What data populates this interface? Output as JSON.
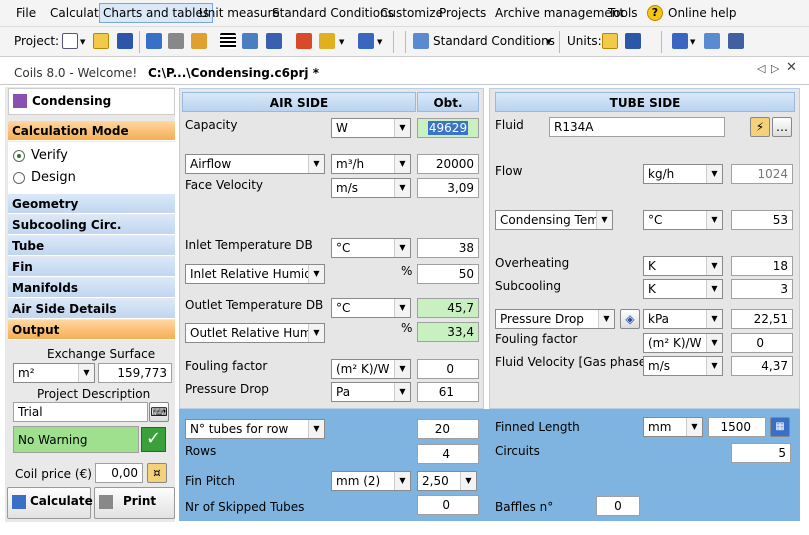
{
  "menu": [
    "File",
    "Calculate",
    "Charts and tables",
    "Unit measure",
    "Standard Conditions",
    "Customize",
    "Projects",
    "Archive management",
    "Tools",
    "Online help"
  ],
  "toolbar": {
    "project_label": "Project:",
    "std_cond": "Standard Conditions",
    "units_label": "Units:"
  },
  "tabs": {
    "welcome": "Coils 8.0 - Welcome!",
    "active": "C:\\P...\\Condensing.c6prj *"
  },
  "left": {
    "title": "Condensing",
    "calc_mode": "Calculation Mode",
    "verify": "Verify",
    "design": "Design",
    "nav": [
      "Geometry",
      "Subcooling Circ.",
      "Tube",
      "Fin",
      "Manifolds",
      "Air Side Details",
      "Output"
    ],
    "exchange_surface_label": "Exchange Surface",
    "exchange_unit": "m²",
    "exchange_value": "159,773",
    "project_desc_label": "Project Description",
    "project_desc": "Trial",
    "warning": "No Warning",
    "coil_price_label": "Coil price (€)",
    "coil_price": "0,00",
    "calculate": "Calculate",
    "print": "Print"
  },
  "air": {
    "header": "AIR SIDE",
    "obt": "Obt.",
    "capacity_label": "Capacity",
    "capacity_unit": "W",
    "capacity_value": "49629",
    "airflow_sel": "Airflow",
    "airflow_unit": "m³/h",
    "airflow_value": "20000",
    "face_vel_label": "Face Velocity",
    "face_vel_unit": "m/s",
    "face_vel_value": "3,09",
    "inlet_temp_label": "Inlet Temperature DB",
    "inlet_temp_unit": "°C",
    "inlet_temp_value": "38",
    "inlet_rh_sel": "Inlet Relative Humidity",
    "inlet_rh_unit": "%",
    "inlet_rh_value": "50",
    "outlet_temp_label": "Outlet Temperature DB",
    "outlet_temp_unit": "°C",
    "outlet_temp_value": "45,7",
    "outlet_rh_sel": "Outlet Relative Humidity",
    "outlet_rh_unit": "%",
    "outlet_rh_value": "33,4",
    "fouling_label": "Fouling factor",
    "fouling_unit": "(m² K)/W",
    "fouling_value": "0",
    "pdrop_label": "Pressure Drop",
    "pdrop_unit": "Pa",
    "pdrop_value": "61"
  },
  "tube": {
    "header": "TUBE SIDE",
    "fluid_label": "Fluid",
    "fluid_value": "R134A",
    "flow_label": "Flow",
    "flow_unit": "kg/h",
    "flow_value": "1024",
    "cond_sel": "Condensing Temp.",
    "cond_unit": "°C",
    "cond_value": "53",
    "overheat_label": "Overheating",
    "overheat_unit": "K",
    "overheat_value": "18",
    "subcool_label": "Subcooling",
    "subcool_unit": "K",
    "subcool_value": "3",
    "pdrop_sel": "Pressure Drop",
    "pdrop_unit": "kPa",
    "pdrop_value": "22,51",
    "fouling_label": "Fouling factor",
    "fouling_unit": "(m² K)/W",
    "fouling_value": "0",
    "fvel_label": "Fluid Velocity [Gas phase]",
    "fvel_unit": "m/s",
    "fvel_value": "4,37"
  },
  "geom": {
    "tubes_row_sel": "N° tubes for row",
    "tubes_row_value": "20",
    "rows_label": "Rows",
    "rows_value": "4",
    "fin_pitch_label": "Fin Pitch",
    "fin_pitch_unit": "mm (2)",
    "fin_pitch_value": "2,50",
    "skipped_label": "Nr of Skipped Tubes",
    "skipped_value": "0",
    "finned_len_label": "Finned Length",
    "finned_len_unit": "mm",
    "finned_len_value": "1500",
    "circuits_label": "Circuits",
    "circuits_value": "5",
    "baffles_label": "Baffles n°",
    "baffles_value": "0"
  },
  "colors": {
    "accent_orange": "#f6ae55",
    "panel_blue": "#7fb3e0",
    "ok_green": "#c8f0c0"
  }
}
